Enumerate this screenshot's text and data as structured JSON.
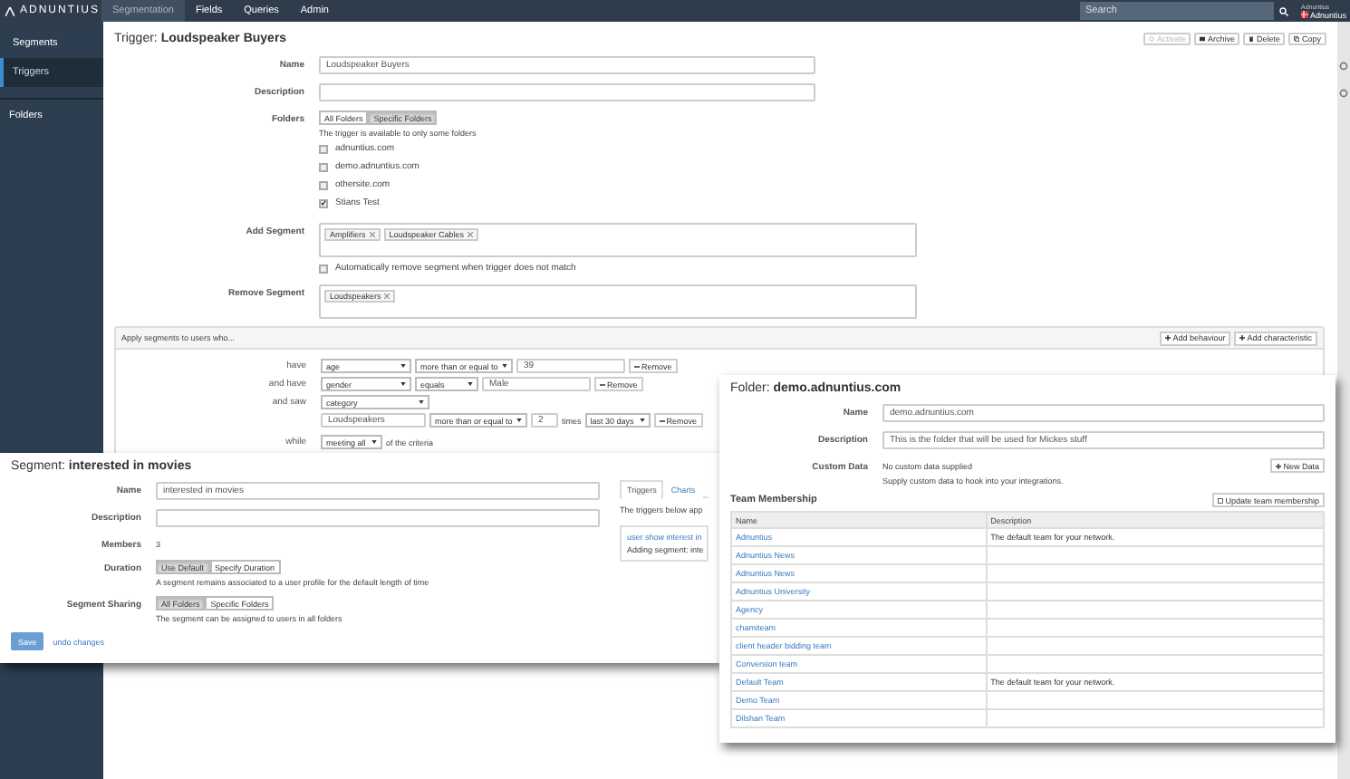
{
  "topbar": {
    "logo": "ADNUNTIUS",
    "nav": [
      {
        "label": "Segmentation",
        "selected": true
      },
      {
        "label": "Fields",
        "selected": false
      },
      {
        "label": "Queries",
        "selected": false
      },
      {
        "label": "Admin",
        "selected": false
      }
    ],
    "search": {
      "placeholder": "Search"
    },
    "user": {
      "network": "Adnuntius",
      "name": "Adnuntius"
    }
  },
  "sidebar": {
    "items": [
      {
        "label": "Segments",
        "selected": false
      },
      {
        "label": "Triggers",
        "selected": true
      }
    ],
    "section": "Folders"
  },
  "trigger": {
    "title_prefix": "Trigger:",
    "title": "Loudspeaker Buyers",
    "actions": [
      {
        "kind": "activate",
        "label": "Activate",
        "disabled": true
      },
      {
        "kind": "archive",
        "label": "Archive",
        "disabled": false
      },
      {
        "kind": "delete",
        "label": "Delete",
        "disabled": false
      },
      {
        "kind": "copy",
        "label": "Copy",
        "disabled": false
      }
    ],
    "name": {
      "label": "Name",
      "value": "Loudspeaker Buyers"
    },
    "description": {
      "label": "Description"
    },
    "folders": {
      "label": "Folders",
      "options": [
        {
          "label": "All Folders",
          "selected": false
        },
        {
          "label": "Specific Folders",
          "selected": true
        }
      ],
      "help": "The trigger is available to only some folders",
      "items": [
        {
          "label": "adnuntius.com",
          "checked": false
        },
        {
          "label": "demo.adnuntius.com",
          "checked": false
        },
        {
          "label": "othersite.com",
          "checked": false
        },
        {
          "label": "Stians Test",
          "checked": true
        }
      ]
    },
    "add_segment": {
      "label": "Add Segment",
      "tags": [
        "Amplifiers",
        "Loudspeaker Cables"
      ],
      "auto_remove": {
        "label": "Automatically remove segment when trigger does not match",
        "checked": false
      }
    },
    "remove_segment": {
      "label": "Remove Segment",
      "tags": [
        "Loudspeakers"
      ]
    },
    "criteria": {
      "title": "Apply segments to users who...",
      "buttons": [
        "Add behaviour",
        "Add characteristic"
      ],
      "rows": [
        {
          "kind": "characteristic",
          "prefix": "have",
          "field": "age",
          "operator": "more than or equal to",
          "value": "39",
          "remove": "Remove"
        },
        {
          "kind": "characteristic",
          "prefix": "and have",
          "field": "gender",
          "operator": "equals",
          "value": "Male",
          "remove": "Remove"
        },
        {
          "kind": "behaviour",
          "prefix": "and saw",
          "field": "category",
          "value": "Loudspeakers",
          "operator": "more than or equal to",
          "count": "2",
          "times": "times",
          "period": "last 30 days",
          "remove": "Remove"
        },
        {
          "kind": "match",
          "prefix": "while",
          "field": "meeting all",
          "suffix": "of the criteria"
        }
      ]
    }
  },
  "segment_window": {
    "title_prefix": "Segment:",
    "title": "interested in movies",
    "name": {
      "label": "Name",
      "value": "interested in movies"
    },
    "description": {
      "label": "Description"
    },
    "members": {
      "label": "Members",
      "value": "3"
    },
    "duration": {
      "label": "Duration",
      "options": [
        {
          "label": "Use Default",
          "selected": true
        },
        {
          "label": "Specify Duration",
          "selected": false
        }
      ],
      "help": "A segment remains associated to a user profile for the default length of time"
    },
    "sharing": {
      "label": "Segment Sharing",
      "options": [
        {
          "label": "All Folders",
          "selected": true
        },
        {
          "label": "Specific Folders",
          "selected": false
        }
      ],
      "help": "The segment can be assigned to users in all folders"
    },
    "save": "Save",
    "undo": "undo changes",
    "tabs": [
      {
        "label": "Triggers",
        "selected": true
      },
      {
        "label": "Charts",
        "selected": false
      }
    ],
    "tab_text": "The triggers below app",
    "trigger_link": "user show interest in",
    "trigger_text": "Adding segment: inte"
  },
  "folder_window": {
    "title_prefix": "Folder:",
    "title": "demo.adnuntius.com",
    "name": {
      "label": "Name",
      "value": "demo.adnuntius.com"
    },
    "description": {
      "label": "Description",
      "value": "This is the folder that will be used for Mickes stuff"
    },
    "custom_data": {
      "label": "Custom Data",
      "value": "No custom data supplied",
      "help": "Supply custom data to hook into your integrations.",
      "button": "New Data"
    },
    "team": {
      "title": "Team Membership",
      "button": "Update team membership",
      "columns": [
        "Name",
        "Description"
      ],
      "rows": [
        {
          "name": "Adnuntius",
          "description": "The default team for your network."
        },
        {
          "name": "Adnuntius News"
        },
        {
          "name": "Adnuntius News"
        },
        {
          "name": "Adnuntius University"
        },
        {
          "name": "Agency"
        },
        {
          "name": "chamiteam"
        },
        {
          "name": "client header bidding team"
        },
        {
          "name": "Conversion team"
        },
        {
          "name": "Default Team",
          "description": "The default team for your network."
        },
        {
          "name": "Demo Team"
        },
        {
          "name": "Dilshan Team"
        }
      ]
    }
  }
}
